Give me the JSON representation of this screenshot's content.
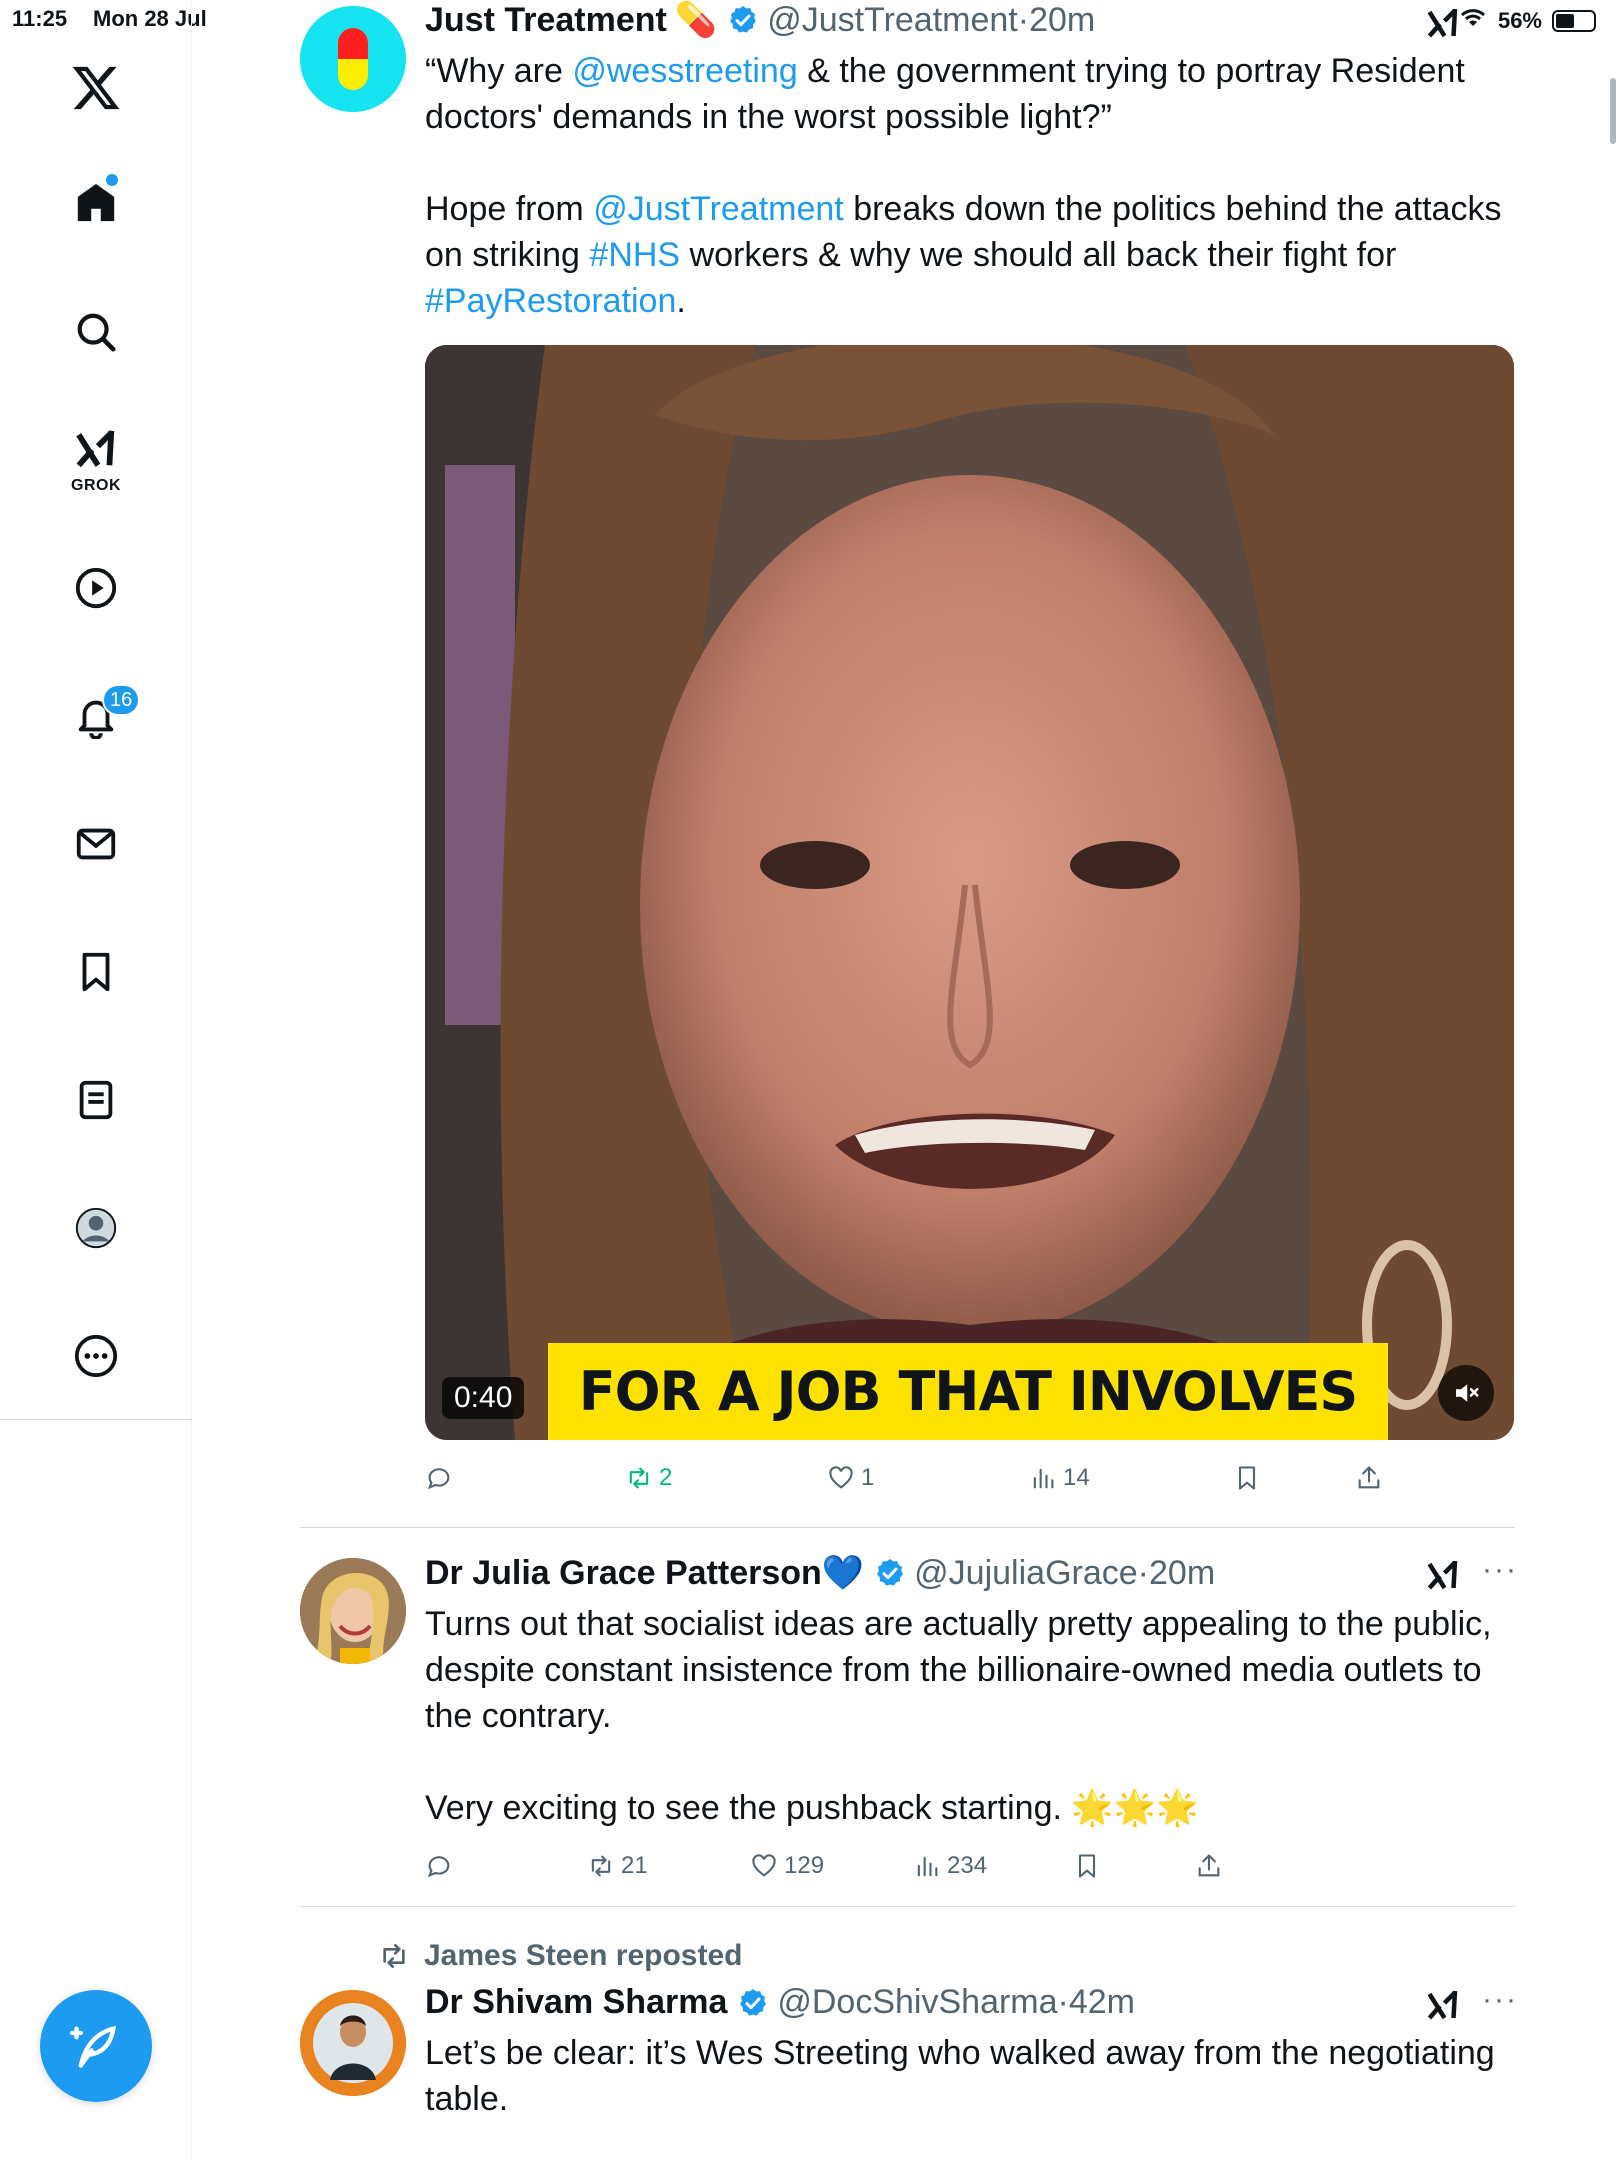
{
  "status_bar": {
    "time": "11:25",
    "date": "Mon 28 Jul",
    "battery": "56%",
    "battery_level": 0.56
  },
  "sidebar": {
    "items": [
      {
        "id": "home",
        "icon": "home-icon"
      },
      {
        "id": "explore",
        "icon": "search-icon"
      },
      {
        "id": "grok",
        "icon": "grok-icon",
        "label": "GROK"
      },
      {
        "id": "videos",
        "icon": "play-icon"
      },
      {
        "id": "notifications",
        "icon": "bell-icon",
        "badge": "16"
      },
      {
        "id": "messages",
        "icon": "mail-icon"
      },
      {
        "id": "bookmarks",
        "icon": "bookmark-icon"
      },
      {
        "id": "lists",
        "icon": "list-icon"
      },
      {
        "id": "profile",
        "icon": "profile-icon"
      },
      {
        "id": "more",
        "icon": "more-circle-icon"
      }
    ],
    "compose_icon": "compose-icon"
  },
  "colors": {
    "accent": "#1d9bf0",
    "text": "#0f1419",
    "muted": "#536471",
    "repost_active": "#00ba7c",
    "caption_bg": "#fde200"
  },
  "tweets": [
    {
      "display_name": "Just Treatment",
      "name_emoji": "💊",
      "handle": "@JustTreatment",
      "time": "20m",
      "body": [
        {
          "parts": [
            {
              "t": "“Why are "
            },
            {
              "t": "@wesstreeting",
              "link": true
            },
            {
              "t": "  & the government trying to portray Resident doctors' demands in the worst possible light?”"
            }
          ]
        },
        {
          "parts": [
            {
              "t": "Hope from "
            },
            {
              "t": "@JustTreatment",
              "link": true
            },
            {
              "t": " breaks down the politics behind the attacks on striking "
            },
            {
              "t": "#NHS",
              "link": true
            },
            {
              "t": " workers & why we should all back their fight for "
            },
            {
              "t": "#PayRestoration",
              "link": true
            },
            {
              "t": "."
            }
          ]
        }
      ],
      "video": {
        "duration": "0:40",
        "caption": "FOR A JOB THAT INVOLVES"
      },
      "stats": {
        "replies": "",
        "reposts": "2",
        "likes": "1",
        "views": "14"
      }
    },
    {
      "display_name": "Dr Julia Grace Patterson",
      "name_emoji": "💙",
      "handle": "@JujuliaGrace",
      "time": "20m",
      "body": [
        {
          "parts": [
            {
              "t": "Turns out that socialist ideas are actually pretty appealing to the public, despite constant insistence from the billionaire-owned media outlets to the contrary."
            }
          ]
        },
        {
          "parts": [
            {
              "t": "Very exciting to see the pushback starting. 🌟🌟🌟"
            }
          ]
        }
      ],
      "stats": {
        "replies": "",
        "reposts": "21",
        "likes": "129",
        "views": "234"
      }
    },
    {
      "reposted_by": "James Steen reposted",
      "display_name": "Dr Shivam Sharma",
      "handle": "@DocShivSharma",
      "time": "42m",
      "body": [
        {
          "parts": [
            {
              "t": "Let’s be clear: it’s Wes Streeting who walked away from the negotiating table."
            }
          ]
        }
      ]
    }
  ],
  "separator": "·"
}
